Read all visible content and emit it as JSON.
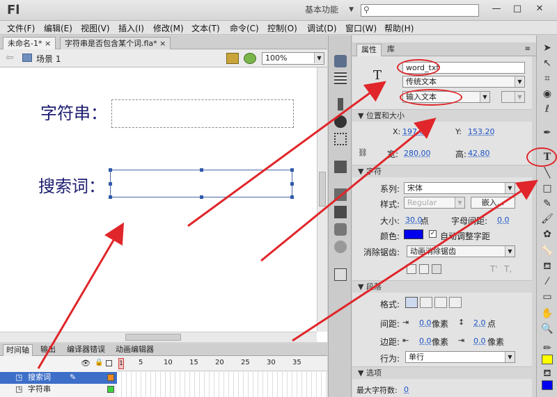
{
  "app": {
    "logo": "Fl",
    "workspace": "基本功能",
    "win_min": "—",
    "win_max": "□",
    "win_close": "✕"
  },
  "menu": [
    "文件(F)",
    "编辑(E)",
    "视图(V)",
    "插入(I)",
    "修改(M)",
    "文本(T)",
    "命令(C)",
    "控制(O)",
    "调试(D)",
    "窗口(W)",
    "帮助(H)"
  ],
  "doc_tabs": [
    "未命名-1*",
    "字符串是否包含某个词.fla*"
  ],
  "editbar": {
    "back": "⇦",
    "scene": "场景 1",
    "zoom": "100%"
  },
  "stage": {
    "label1": "字符串：",
    "label2": "搜索词："
  },
  "timeline": {
    "tabs": [
      "时间轴",
      "输出",
      "编译器错误",
      "动画编辑器"
    ],
    "frame_numbers": [
      "1",
      "5",
      "10",
      "15",
      "20",
      "25",
      "30",
      "35"
    ],
    "layers": [
      {
        "name": "搜索词"
      },
      {
        "name": "字符串"
      }
    ]
  },
  "props": {
    "tabs": [
      "属性",
      "库"
    ],
    "instance_name": "word_txt",
    "text_engine": "传统文本",
    "text_type": "输入文本",
    "sections": {
      "pos": "位置和大小",
      "char": "字符",
      "para": "段落",
      "options": "选项"
    },
    "x_label": "X:",
    "x_value": "197.00",
    "y_label": "Y:",
    "y_value": "153.20",
    "w_label": "宽:",
    "w_value": "280.00",
    "h_label": "高:",
    "h_value": "42.80",
    "family_label": "系列:",
    "family_value": "宋体",
    "style_label": "样式:",
    "style_value": "Regular",
    "embed_btn": "嵌入...",
    "size_label": "大小:",
    "size_value": "30.0",
    "size_unit": "点",
    "spacing_label": "字母间距:",
    "spacing_value": "0.0",
    "color_label": "颜色:",
    "color_hex": "#0000ee",
    "autokern_label": "自动调整字距",
    "aa_label": "消除锯齿:",
    "aa_value": "动画消除锯齿",
    "format_label": "格式:",
    "gap_label": "间距:",
    "gap1": "0.0",
    "gap_unit": "像素",
    "gap2": "2.0",
    "gap2_unit": "点",
    "margin_label": "边距:",
    "margin1": "0.0",
    "margin2": "0.0",
    "margin_unit": "像素",
    "behavior_label": "行为:",
    "behavior_value": "单行",
    "maxchars_label": "最大字符数:",
    "maxchars_value": "0"
  }
}
